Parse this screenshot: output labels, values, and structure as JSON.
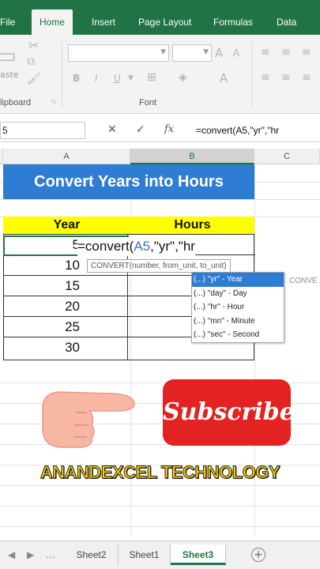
{
  "ribbon_tabs": [
    "File",
    "Home",
    "Insert",
    "Page Layout",
    "Formulas",
    "Data"
  ],
  "active_ribbon_tab": "Home",
  "ribbon": {
    "paste_label": "aste",
    "clipboard_label": "lipboard",
    "font_label": "Font",
    "bold": "B",
    "italic": "I",
    "underline": "U",
    "grow_font": "A",
    "shrink_font": "A",
    "font_color": "A"
  },
  "formula_bar": {
    "name_box": "5",
    "cancel": "✕",
    "enter": "✓",
    "fx": "fx",
    "formula": "=convert(A5,\"yr\",\"hr"
  },
  "columns": [
    "A",
    "B",
    "C"
  ],
  "sheet": {
    "title": "Convert Years into Hours",
    "header_year": "Year",
    "header_hours": "Hours",
    "years": [
      "5",
      "10",
      "15",
      "20",
      "25",
      "30"
    ],
    "edit_prefix": "=convert(",
    "edit_ref": "A5",
    "edit_suffix": ",\"yr\",\"hr",
    "tooltip": "CONVERT(number, from_unit, to_unit)",
    "autocomplete": [
      "(...) \"yr\" - Year",
      "(...) \"day\" - Day",
      "(...) \"hr\" - Hour",
      "(...) \"mn\" - Minute",
      "(...) \"sec\" - Second"
    ],
    "ghost_text": "CONVE"
  },
  "overlay": {
    "subscribe": "Subscribe",
    "brand": "ANANDEXCEL TECHNOLOGY"
  },
  "sheet_tabs": [
    "Sheet2",
    "Sheet1",
    "Sheet3"
  ],
  "active_sheet": "Sheet3",
  "colors": {
    "excel_green": "#217346",
    "title_blue": "#2f7cd3",
    "header_yellow": "#ffff00",
    "subscribe_red": "#e32222",
    "brand_yellow": "#ffd200"
  }
}
